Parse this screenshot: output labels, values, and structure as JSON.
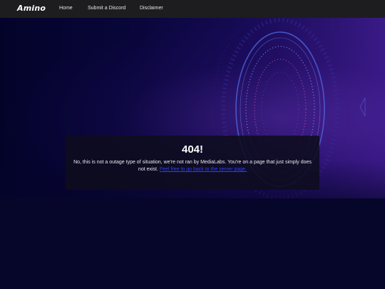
{
  "navbar": {
    "logo_text": "Amino",
    "links": [
      "Home",
      "Submit a Discord",
      "Disclaimer"
    ]
  },
  "error": {
    "title": "404!",
    "message": "No, this is not a outage type of situation, we're not ran by MediaLabs. You're on a page that just simply does not exist.",
    "link_text": "Feel free to go back to the server page."
  },
  "colors": {
    "navbar_bg": "#1d1d1f",
    "page_bg": "#06052a",
    "link": "#2f3fff",
    "accent_purple": "#3a1a86"
  },
  "icons": [
    "portal-rings-graphic"
  ]
}
